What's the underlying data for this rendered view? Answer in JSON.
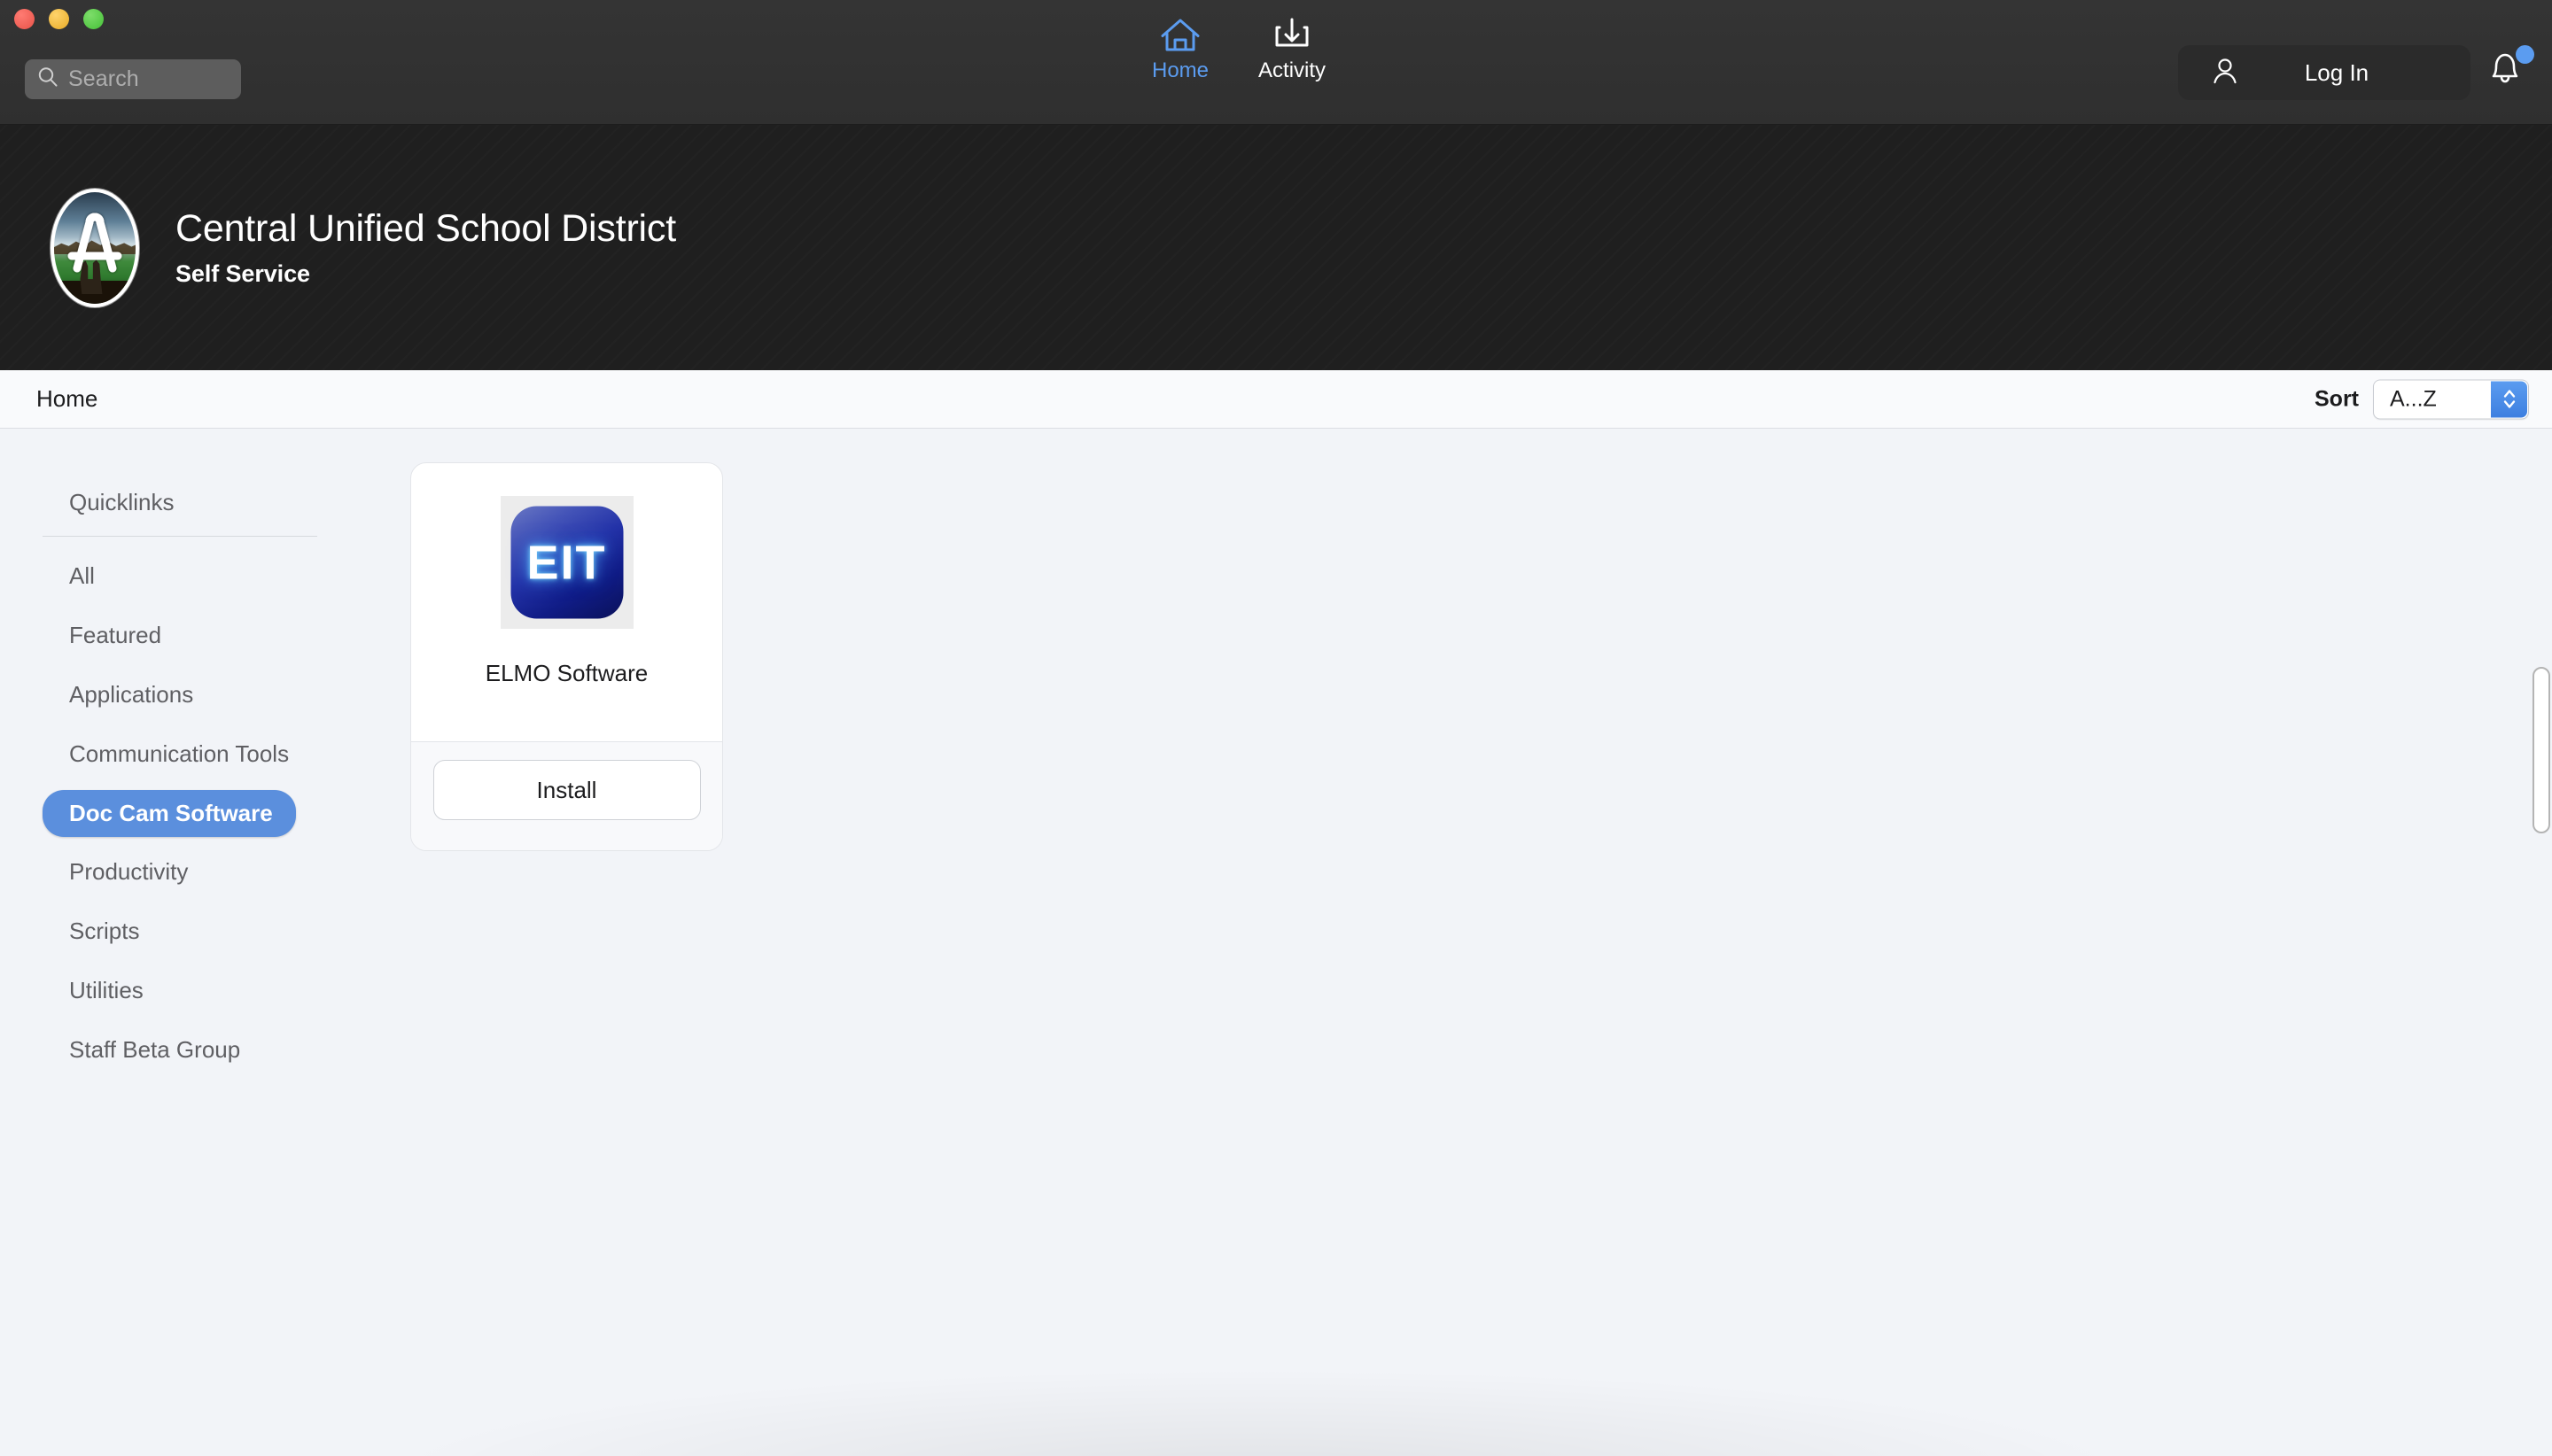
{
  "window": {
    "traffic_lights": [
      "close",
      "minimize",
      "maximize"
    ]
  },
  "toolbar": {
    "search": {
      "placeholder": "Search",
      "value": "",
      "icon": "search-icon"
    },
    "nav": [
      {
        "label": "Home",
        "icon": "home-icon",
        "active": true
      },
      {
        "label": "Activity",
        "icon": "download-tray-icon",
        "active": false
      }
    ],
    "login": {
      "label": "Log In",
      "icon": "person-icon"
    },
    "notifications": {
      "icon": "bell-icon",
      "has_badge": true,
      "badge_color": "#5b9cf0"
    }
  },
  "brand": {
    "logo_alt": "Central Unified School District seal",
    "title": "Central Unified School District",
    "subtitle": "Self Service"
  },
  "subbar": {
    "breadcrumb": "Home",
    "sort_label": "Sort",
    "sort_value": "A...Z",
    "sort_options": [
      "A...Z"
    ]
  },
  "sidebar": {
    "heading": "Quicklinks",
    "items": [
      {
        "label": "All",
        "active": false
      },
      {
        "label": "Featured",
        "active": false
      },
      {
        "label": "Applications",
        "active": false
      },
      {
        "label": "Communication Tools",
        "active": false
      },
      {
        "label": "Doc Cam Software",
        "active": true
      },
      {
        "label": "Productivity",
        "active": false
      },
      {
        "label": "Scripts",
        "active": false
      },
      {
        "label": "Utilities",
        "active": false
      },
      {
        "label": "Staff Beta Group",
        "active": false
      }
    ]
  },
  "main": {
    "cards": [
      {
        "title": "ELMO Software",
        "icon_text": "EIT",
        "action_label": "Install"
      }
    ]
  },
  "colors": {
    "accent_blue": "#5b9cf0",
    "active_pill": "#5b8fdd",
    "toolbar_bg": "#323232",
    "brand_bg": "#1f1f1f",
    "page_bg": "#f2f4f8"
  }
}
